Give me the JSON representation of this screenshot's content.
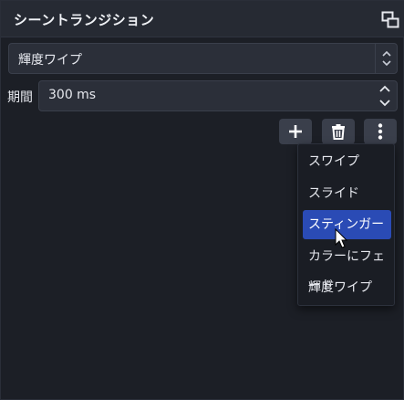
{
  "panel": {
    "title": "シーントランジション",
    "undock_icon": "undock-icon"
  },
  "transition_select": {
    "value": "輝度ワイプ"
  },
  "duration": {
    "label": "期間",
    "value": "300 ms"
  },
  "toolbar": {
    "add_icon": "plus-icon",
    "remove_icon": "trash-icon",
    "more_icon": "vertical-dots-icon"
  },
  "menu": {
    "items": [
      {
        "label": "スワイプ",
        "selected": false
      },
      {
        "label": "スライド",
        "selected": false
      },
      {
        "label": "スティンガー",
        "selected": true
      },
      {
        "label": "カラーにフェード",
        "selected": false
      },
      {
        "label": "輝度ワイプ",
        "selected": false
      }
    ]
  },
  "colors": {
    "background": "#1c1f26",
    "header": "#262a33",
    "field": "#2b2f39",
    "highlight": "#2a4bb5"
  }
}
